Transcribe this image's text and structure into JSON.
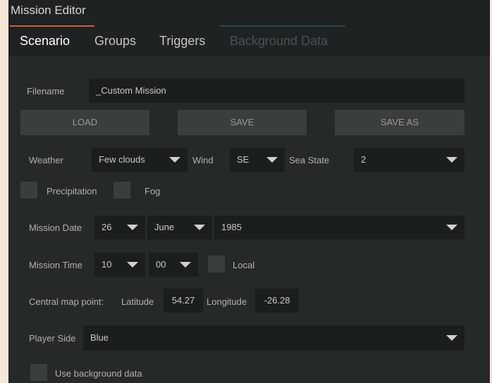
{
  "window": {
    "title": "Mission Editor"
  },
  "tabs": [
    {
      "label": "Scenario",
      "state": "active"
    },
    {
      "label": "Groups",
      "state": "normal"
    },
    {
      "label": "Triggers",
      "state": "normal"
    },
    {
      "label": "Background Data",
      "state": "disabled"
    }
  ],
  "filename": {
    "label": "Filename",
    "value": "_Custom Mission"
  },
  "buttons": {
    "load": "LOAD",
    "save": "SAVE",
    "save_as": "SAVE AS"
  },
  "weather": {
    "label": "Weather",
    "value": "Few clouds",
    "wind_label": "Wind",
    "wind_value": "SE",
    "sea_state_label": "Sea State",
    "sea_state_value": "2"
  },
  "options": {
    "precipitation": "Precipitation",
    "fog": "Fog"
  },
  "mission_date": {
    "label": "Mission Date",
    "day": "26",
    "month": "June",
    "year": "1985"
  },
  "mission_time": {
    "label": "Mission Time",
    "hour": "10",
    "minute": "00",
    "local_label": "Local"
  },
  "map_point": {
    "label": "Central map point:",
    "latitude_label": "Latitude",
    "latitude": "54.27",
    "longitude_label": "Longitude",
    "longitude": "-26.28"
  },
  "player_side": {
    "label": "Player Side",
    "value": "Blue"
  },
  "background": {
    "label": "Use background data"
  },
  "icons": {
    "dropdown": "chevron-down-icon",
    "checkbox": "checkbox-icon"
  },
  "colors": {
    "accent": "#d9573a",
    "panel": "#26292a",
    "field": "#1b1e1f",
    "button": "#3a3e3f"
  }
}
